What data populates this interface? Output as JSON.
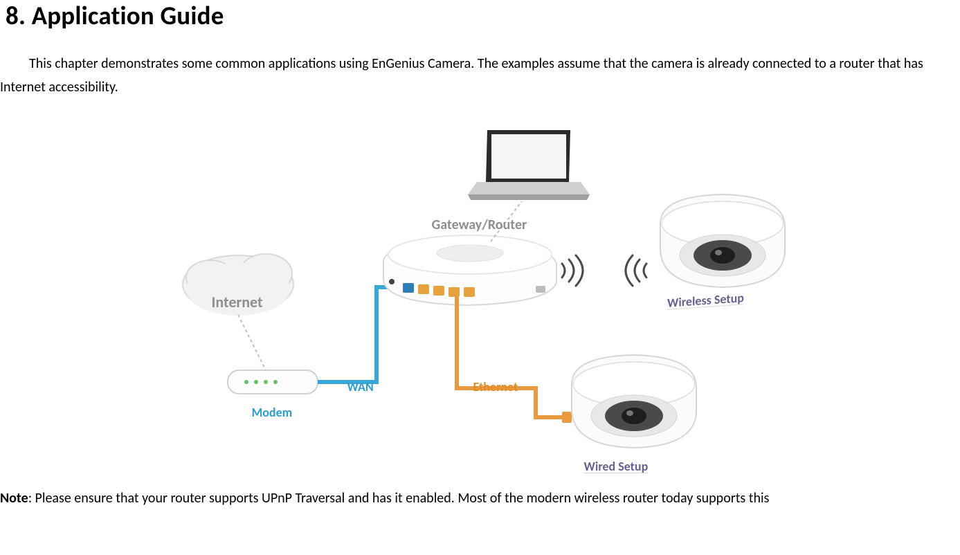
{
  "heading": "8. Application Guide",
  "intro": "This chapter demonstrates some common applications using EnGenius Camera. The examples assume that the camera is already connected to a router that has Internet accessibility.",
  "diagram": {
    "internet": "Internet",
    "modem": "Modem",
    "wan": "WAN",
    "gateway": "Gateway/Router",
    "ethernet": "Ethernet",
    "wireless": "Wireless Setup",
    "wired": "Wired Setup"
  },
  "note_label": "Note",
  "note_body": ": Please ensure that your router supports UPnP Traversal and has it enabled. Most of the modern wireless router today supports this"
}
